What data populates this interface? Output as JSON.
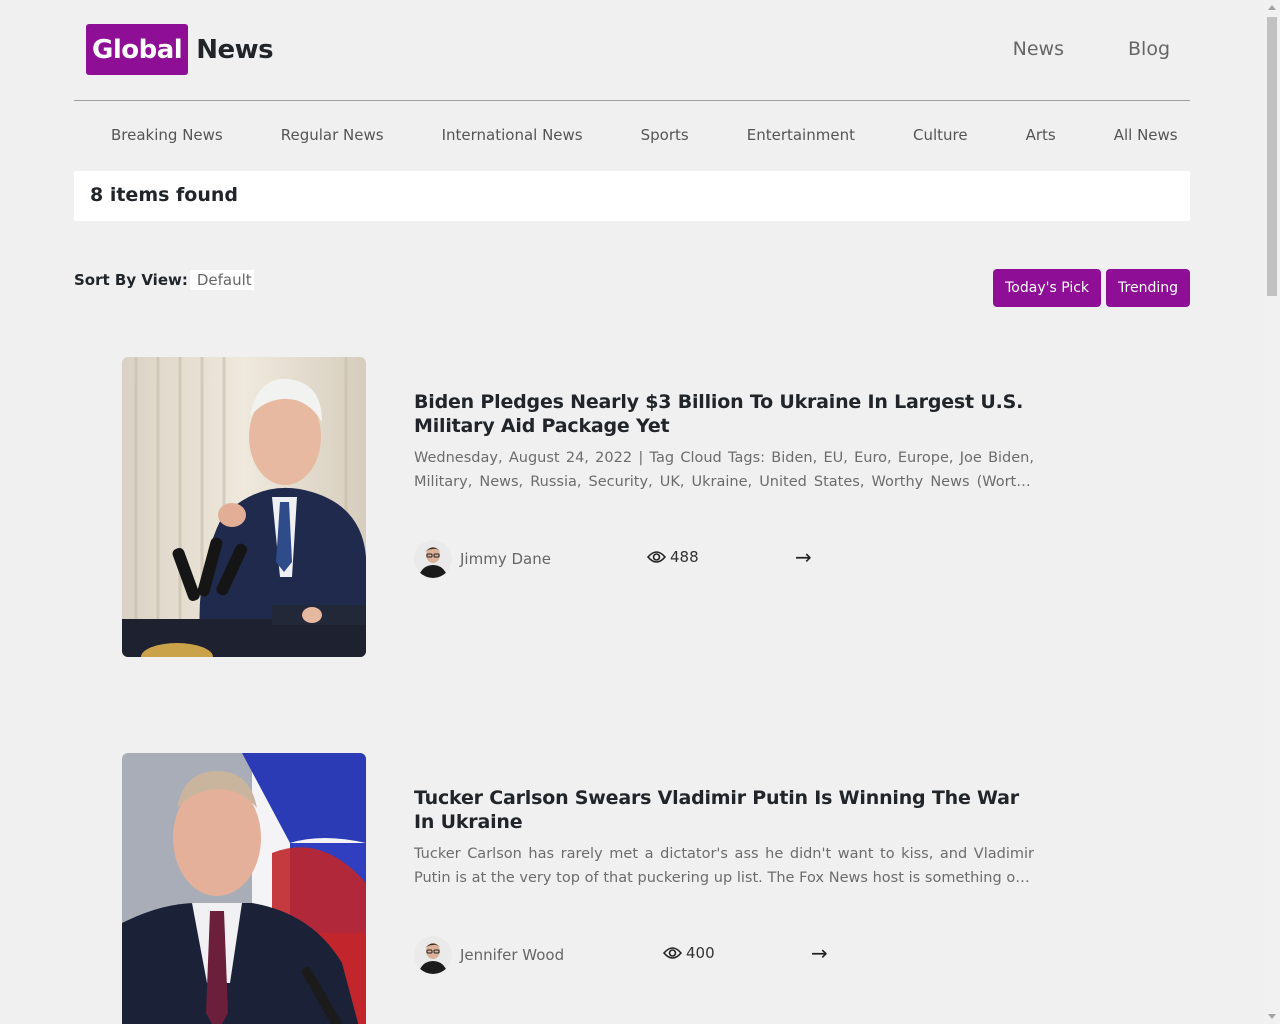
{
  "brand": {
    "highlight": "Global",
    "rest": "News",
    "accent_color": "#8e0e96"
  },
  "top_nav": [
    "News",
    "Blog"
  ],
  "categories": [
    "Breaking News",
    "Regular News",
    "International News",
    "Sports",
    "Entertainment",
    "Culture",
    "Arts",
    "All News"
  ],
  "results_text": "8 items found",
  "sort": {
    "label": "Sort By View:",
    "value": "Default"
  },
  "pick_buttons": [
    "Today's Pick",
    "Trending"
  ],
  "articles": [
    {
      "title": "Biden Pledges Nearly $3 Billion To Ukraine In Largest U.S. Military Aid Package Yet",
      "excerpt": "Wednesday, August 24, 2022 | Tag Cloud Tags: Biden, EU, Euro, Europe, Joe Biden, Military, News, Russia, Security, UK, Ukraine, United States, Worthy News (Worthy Ne...",
      "author": "Jimmy Dane",
      "views": "488"
    },
    {
      "title": "Tucker Carlson Swears Vladimir Putin Is Winning The War In Ukraine",
      "excerpt": "Tucker Carlson has rarely met a dictator's ass he didn't want to kiss, and Vladimir Putin is at the very top of that puckering up list. The Fox News host is something of a fo...",
      "author": "Jennifer Wood",
      "views": "400"
    }
  ],
  "icons": {
    "views": "eye-icon",
    "read_more": "arrow-right-icon"
  }
}
